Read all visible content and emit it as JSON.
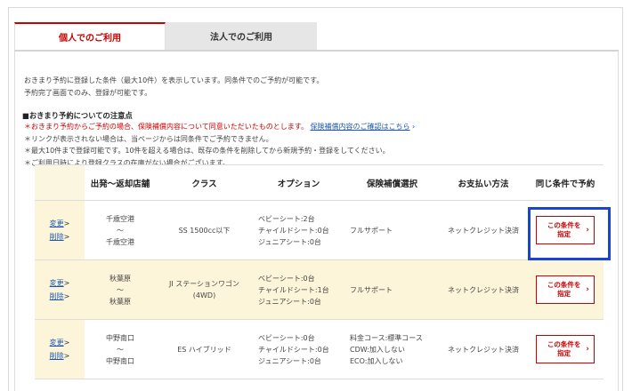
{
  "tabs": {
    "personal": "個人でのご利用",
    "corporate": "法人でのご利用"
  },
  "intro": {
    "line1": "おきまり予約に登録した条件（最大10件）を表示しています。同条件でのご予約が可能です。",
    "line2": "予約完了画面でのみ、登録が可能です。"
  },
  "notes": {
    "title": "■おきまり予約についての注意点",
    "items": [
      "＊おきまり予約からご予約の場合、保険補償内容について同意いただいたものとします。",
      "＊リンクが表示されない場合は、当ページからは同条件でご予約できません。",
      "＊最大10件まで登録可能です。10件を超える場合は、既存の条件を削除してから新規予約・登録をしてください。",
      "＊ご利用日時により登録クラスの在庫がない場合がございます。"
    ],
    "link": "保険補償内容のご確認はこちら"
  },
  "table": {
    "headers": [
      "",
      "出発～返却店舗",
      "クラス",
      "オプション",
      "保険補償選択",
      "お支払い方法",
      "同じ条件で予約"
    ],
    "edit_label": "変更",
    "delete_label": "削除",
    "arrow": ">",
    "tilde": "～",
    "select_label_1": "この条件を",
    "select_label_2": "指定",
    "rows": [
      {
        "depart": "千歳空港",
        "return": "千歳空港",
        "class": "SS 1500cc以下",
        "class2": "",
        "options": [
          "ベビーシート:2台",
          "チャイルドシート:0台",
          "ジュニアシート:0台"
        ],
        "insurance": [
          "フルサポート"
        ],
        "payment": "ネットクレジット決済"
      },
      {
        "depart": "秋葉原",
        "return": "秋葉原",
        "class": "JI ステーションワゴン",
        "class2": "(4WD)",
        "options": [
          "ベビーシート:0台",
          "チャイルドシート:1台",
          "ジュニアシート:0台"
        ],
        "insurance": [
          "フルサポート"
        ],
        "payment": "ネットクレジット決済"
      },
      {
        "depart": "中野南口",
        "return": "中野南口",
        "class": "ES ハイブリッド",
        "class2": "",
        "options": [
          "ベビーシート:0台",
          "チャイルドシート:0台",
          "ジュニアシート:0台"
        ],
        "insurance": [
          "料金コース:標準コース",
          "CDW:加入しない",
          "ECO:加入しない"
        ],
        "payment": "ネットクレジット決済"
      }
    ]
  },
  "colors": {
    "accent_red": "#cc0000",
    "link_blue": "#1a56b3",
    "highlight_blue": "#1845d6",
    "row_tint": "#fdf5d9"
  }
}
